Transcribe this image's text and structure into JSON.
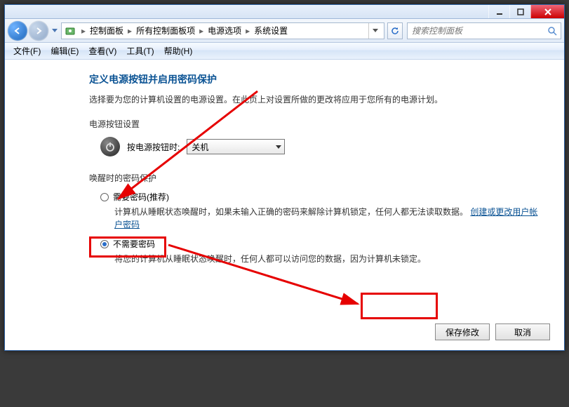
{
  "titlebar": {
    "minimize": "minimize",
    "maximize": "maximize",
    "close": "close"
  },
  "breadcrumb": {
    "items": [
      "控制面板",
      "所有控制面板项",
      "电源选项",
      "系统设置"
    ]
  },
  "search": {
    "placeholder": "搜索控制面板"
  },
  "menubar": {
    "items": [
      "文件(F)",
      "编辑(E)",
      "查看(V)",
      "工具(T)",
      "帮助(H)"
    ]
  },
  "page": {
    "title": "定义电源按钮并启用密码保护",
    "desc": "选择要为您的计算机设置的电源设置。在此页上对设置所做的更改将应用于您所有的电源计划。",
    "section_power": "电源按钮设置",
    "power_button_label": "按电源按钮时:",
    "power_button_value": "关机",
    "section_password": "唤醒时的密码保护",
    "opt1_label": "需要密码(推荐)",
    "opt1_desc_a": "计算机从睡眠状态唤醒时，如果未输入正确的密码来解除计算机锁定，任何人都无法读取数据。",
    "opt1_link": "创建或更改用户帐户密码",
    "opt2_label": "不需要密码",
    "opt2_desc": "将您的计算机从睡眠状态唤醒时，任何人都可以访问您的数据，因为计算机未锁定。",
    "btn_save": "保存修改",
    "btn_cancel": "取消"
  }
}
